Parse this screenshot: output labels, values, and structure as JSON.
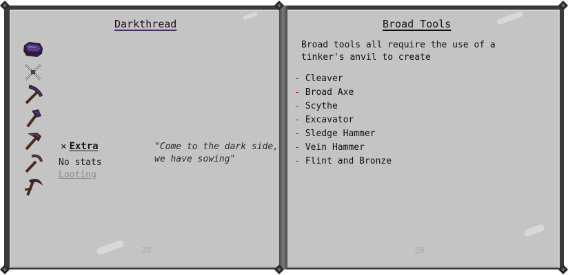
{
  "left_page": {
    "title": "Darkthread",
    "modifier": {
      "symbol": "✕",
      "name": "Extra"
    },
    "stats": "No stats",
    "link": "Looting",
    "quote_line1": "\"Come to the dark side,",
    "quote_line2": "we have sowing\"",
    "page_number": "38",
    "icons": [
      "darkthread-material-icon",
      "crossed-swords-icon",
      "pickaxe-icon",
      "hatchet-icon",
      "mattock-icon",
      "kama-icon",
      "scythe-icon"
    ]
  },
  "right_page": {
    "title": "Broad Tools",
    "intro": "Broad tools all require the use of a tinker's anvil to create",
    "bullet": "-",
    "tools": [
      "Cleaver",
      "Broad Axe",
      "Scythe",
      "Excavator",
      "Sledge Hammer",
      "Vein Hammer",
      "Flint and Bronze"
    ],
    "page_number": "39"
  },
  "colors": {
    "page": "#c4c4c4",
    "cover": "#3a3a3a",
    "bullet": "#b01818",
    "darkthread_title": "#1c0f2e"
  }
}
